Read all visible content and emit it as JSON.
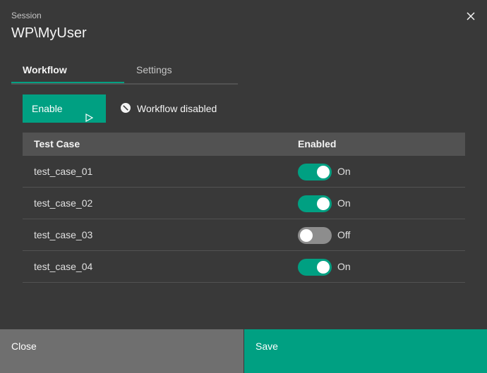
{
  "header": {
    "label": "Session",
    "title": "WP\\MyUser"
  },
  "tabs": [
    {
      "label": "Workflow",
      "active": true
    },
    {
      "label": "Settings",
      "active": false
    }
  ],
  "toolbar": {
    "enable_label": "Enable",
    "status_text": "Workflow disabled"
  },
  "table": {
    "headers": [
      "Test Case",
      "Enabled"
    ],
    "rows": [
      {
        "name": "test_case_01",
        "enabled": true,
        "state_label": "On"
      },
      {
        "name": "test_case_02",
        "enabled": true,
        "state_label": "On"
      },
      {
        "name": "test_case_03",
        "enabled": false,
        "state_label": "Off"
      },
      {
        "name": "test_case_04",
        "enabled": true,
        "state_label": "On"
      }
    ]
  },
  "footer": {
    "close_label": "Close",
    "save_label": "Save"
  },
  "colors": {
    "accent": "#00a082",
    "background": "#393939",
    "header_row": "#525252",
    "close_button": "#6f6f6f"
  },
  "icons": {
    "close": "close-icon",
    "play": "play-icon",
    "status": "blocked-icon"
  }
}
